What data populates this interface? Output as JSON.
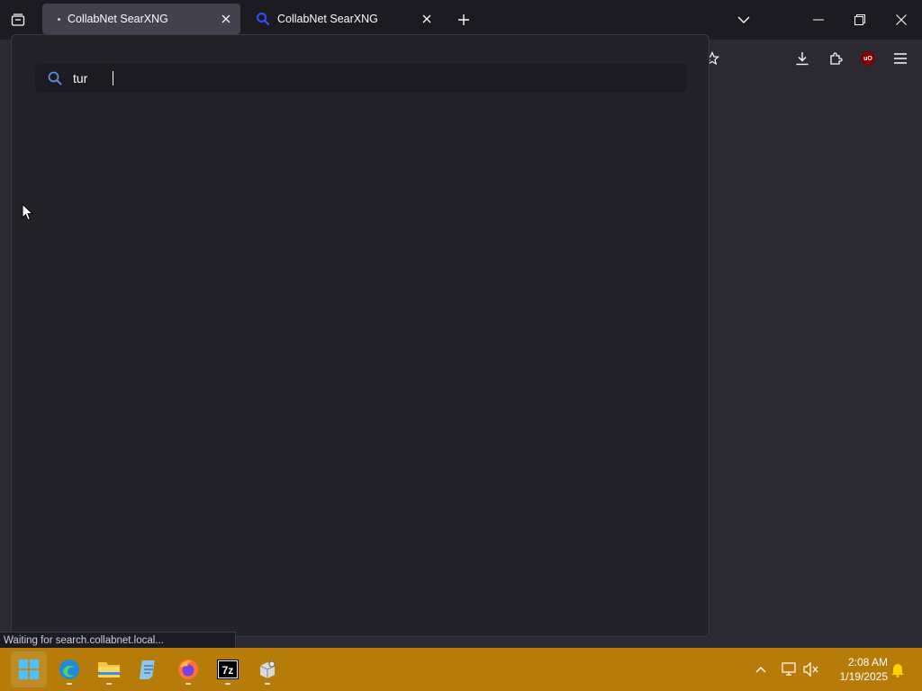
{
  "tabs": [
    {
      "title": "CollabNet SearXNG",
      "active": true
    },
    {
      "title": "CollabNet SearXNG",
      "active": false
    }
  ],
  "search": {
    "value": "tur",
    "placeholder": ""
  },
  "status_text": "Waiting for search.collabnet.local...",
  "clock": {
    "time": "2:08 AM",
    "date": "1/19/2025"
  },
  "colors": {
    "taskbar": "#b77b0a",
    "panel": "#232228",
    "tab_active": "#42414d",
    "searchxng_icon": "#3050ff"
  },
  "icons": {
    "tab_overview": "firefox-view-icon",
    "tab_close": "close-icon",
    "new_tab": "plus-icon",
    "list_tabs": "chevron-down-icon",
    "downloads": "download-icon",
    "extensions": "puzzle-icon",
    "ublock": "ublock-origin-icon",
    "menu": "hamburger-menu-icon",
    "search": "search-icon",
    "taskbar_apps": [
      "windows-start-icon",
      "edge-icon",
      "file-explorer-icon",
      "notepad-icon",
      "firefox-icon",
      "7zip-icon",
      "installer-icon"
    ],
    "tray": [
      "chevron-up-icon",
      "network-icon",
      "volume-muted-icon",
      "notification-bell-icon"
    ]
  },
  "taskbar": {
    "sevenzip_label": "7z"
  },
  "ublock_label": "uO"
}
